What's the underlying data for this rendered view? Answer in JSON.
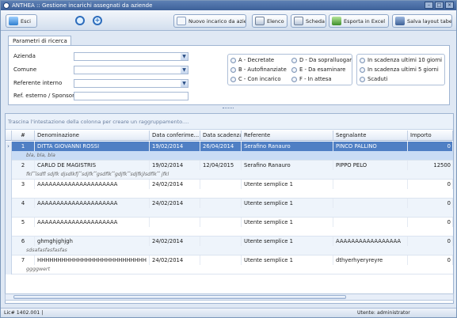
{
  "window": {
    "title": "ANTHEA :: Gestione incarichi assegnati da aziende"
  },
  "toolbar": {
    "exit_label": "Esci",
    "new_label": "Nuovo incarico da azienda",
    "list_label": "Elenco",
    "card_label": "Scheda",
    "excel_label": "Esporta in Excel",
    "save_layout_label": "Salva layout tabella"
  },
  "search": {
    "tab_label": "Parametri di ricerca",
    "azienda_label": "Azienda",
    "comune_label": "Comune",
    "referente_label": "Referente interno",
    "ref_esterno_label": "Ref. esterno / Sponsor",
    "azienda_value": "",
    "comune_value": "",
    "referente_value": "",
    "ref_esterno_value": "",
    "status_col1": [
      "A - Decretate",
      "B - Autofinanziate",
      "C - Con incarico"
    ],
    "status_col2": [
      "D - Da sopralluogare",
      "E - Da esaminare",
      "F - In attesa"
    ],
    "deadlines": [
      "In scadenza ultimi 10 giorni",
      "In scadenza ultimi 5 giorni",
      "Scaduti"
    ]
  },
  "grid": {
    "group_hint": "Trascina l'intestazione della colonna per creare un raggruppamento....",
    "columns": [
      "#",
      "Denominazione",
      "Data conferime...",
      "Data scadenza",
      "Referente",
      "Segnalante",
      "Importo"
    ],
    "rows": [
      {
        "num": "1",
        "name": "DITTA GIOVANNI ROSSI",
        "conf": "19/02/2014",
        "scad": "26/04/2014",
        "ref": "Serafino Ranauro",
        "segn": "PINCO PALLINO",
        "imp": "0",
        "note": "bla, bla, bla",
        "selected": true
      },
      {
        "num": "2",
        "name": "CARLO DE MAGISTRIS",
        "conf": "19/02/2014",
        "scad": "12/04/2015",
        "ref": "Serafino Ranauro",
        "segn": "PIPPO PELO",
        "imp": "12500",
        "note": "fkl ̂ ̂ïsdfl sdjfk djsdlkfj ̂ ̂sdjfk ̂ ̂gsdflk ̂ ̂gdjfk ̂ ̂sdjfkjlsdflk ̂ ̂ jfkl",
        "selected": false
      },
      {
        "num": "3",
        "name": "AAAAAAAAAAAAAAAAAAAAA",
        "conf": "24/02/2014",
        "scad": "",
        "ref": "Utente semplice 1",
        "segn": "",
        "imp": "0",
        "note": "",
        "selected": false
      },
      {
        "num": "4",
        "name": "AAAAAAAAAAAAAAAAAAAAA",
        "conf": "24/02/2014",
        "scad": "",
        "ref": "Utente semplice 1",
        "segn": "",
        "imp": "0",
        "note": "",
        "selected": false
      },
      {
        "num": "5",
        "name": "AAAAAAAAAAAAAAAAAAAAA",
        "conf": "",
        "scad": "",
        "ref": "Utente semplice 1",
        "segn": "",
        "imp": "0",
        "note": "",
        "selected": false
      },
      {
        "num": "6",
        "name": "ghmghjghjgh",
        "conf": "24/02/2014",
        "scad": "",
        "ref": "Utente semplice 1",
        "segn": "AAAAAAAAAAAAAAAAA",
        "imp": "0",
        "note": "sdsafasfasfasfas",
        "selected": false
      },
      {
        "num": "7",
        "name": "HHHHHHHHHHHHHHHHHHHHHHHHHHH",
        "conf": "24/02/2014",
        "scad": "",
        "ref": "Utente semplice 1",
        "segn": "dthyerhyeryreyre",
        "imp": "0",
        "note": "ggggwert",
        "selected": false
      }
    ]
  },
  "status": {
    "license": "Lic# 1402.001 |",
    "user": "Utente: administrator"
  }
}
